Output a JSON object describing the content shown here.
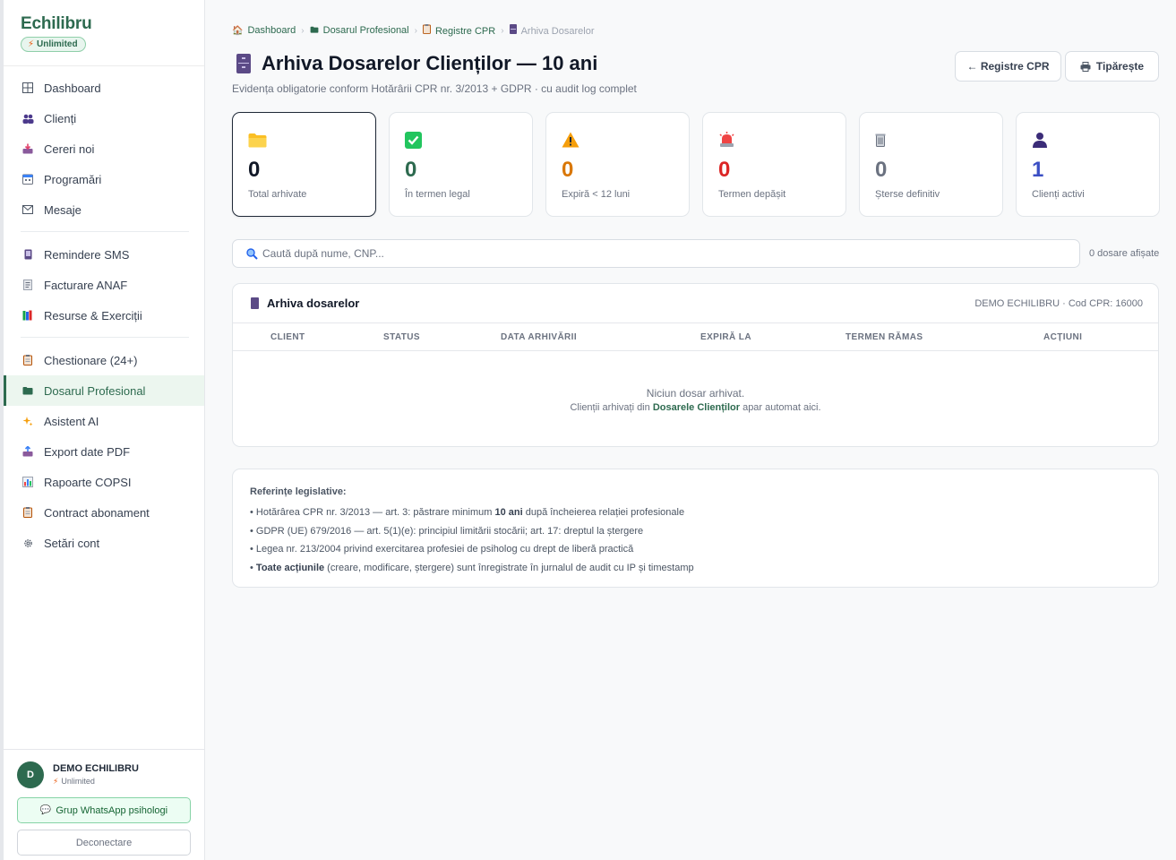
{
  "sidebar": {
    "brand": "Echilibru",
    "plan": "Unlimited",
    "groups": [
      [
        {
          "label": "Dashboard",
          "icon": "grid-icon"
        },
        {
          "label": "Clienți",
          "icon": "people-icon"
        },
        {
          "label": "Cereri noi",
          "icon": "inbox-tray-icon"
        },
        {
          "label": "Programări",
          "icon": "calendar-icon"
        },
        {
          "label": "Mesaje",
          "icon": "envelope-icon"
        }
      ],
      [
        {
          "label": "Remindere SMS",
          "icon": "mobile-phone-icon"
        },
        {
          "label": "Facturare ANAF",
          "icon": "receipt-icon"
        },
        {
          "label": "Resurse & Exerciții",
          "icon": "books-icon"
        }
      ],
      [
        {
          "label": "Chestionare (24+)",
          "icon": "clipboard-icon"
        },
        {
          "label": "Dosarul Profesional",
          "icon": "folder-icon",
          "active": true
        },
        {
          "label": "Asistent AI",
          "icon": "sparkles-icon"
        },
        {
          "label": "Export date PDF",
          "icon": "outbox-tray-icon"
        },
        {
          "label": "Rapoarte COPSI",
          "icon": "bar-chart-icon"
        },
        {
          "label": "Contract abonament",
          "icon": "document-icon"
        },
        {
          "label": "Setări cont",
          "icon": "gear-icon"
        }
      ]
    ],
    "user": {
      "initial": "D",
      "name": "DEMO ECHILIBRU",
      "plan": "Unlimited"
    },
    "whatsapp_label": "Grup WhatsApp psihologi",
    "logout_label": "Deconectare"
  },
  "breadcrumb": [
    {
      "label": "Dashboard",
      "icon": "house-icon"
    },
    {
      "label": "Dosarul Profesional",
      "icon": "folder-icon"
    },
    {
      "label": "Registre CPR",
      "icon": "clipboard-icon"
    },
    {
      "label": "Arhiva Dosarelor",
      "icon": "file-cabinet-icon",
      "current": true
    }
  ],
  "page": {
    "title": "Arhiva Dosarelor Clienților — 10 ani",
    "subtitle": "Evidența obligatorie conform Hotărârii CPR nr. 3/2013 + GDPR · cu audit log complet",
    "back_button": "← Registre CPR",
    "print_button": "Tipărește"
  },
  "stats": [
    {
      "value": "0",
      "label": "Total arhivate",
      "icon": "folder-icon",
      "color": "#111827",
      "selected": true
    },
    {
      "value": "0",
      "label": "În termen legal",
      "icon": "check-box-icon",
      "color": "#2d6a4f"
    },
    {
      "value": "0",
      "label": "Expiră < 12 luni",
      "icon": "warning-icon",
      "color": "#d97706"
    },
    {
      "value": "0",
      "label": "Termen depășit",
      "icon": "siren-icon",
      "color": "#dc2626"
    },
    {
      "value": "0",
      "label": "Șterse definitiv",
      "icon": "trash-icon",
      "color": "#6b7280"
    },
    {
      "value": "1",
      "label": "Clienți activi",
      "icon": "user-icon",
      "color": "#3b4fc4"
    }
  ],
  "search": {
    "placeholder": "Caută după nume, CNP...",
    "count_text": "0 dosare afișate"
  },
  "archive": {
    "title": "Arhiva dosarelor",
    "meta": "DEMO ECHILIBRU · Cod CPR: 16000",
    "columns": [
      "CLIENT",
      "STATUS",
      "DATA ARHIVĂRII",
      "EXPIRĂ LA",
      "TERMEN RĂMAS",
      "ACȚIUNI"
    ],
    "empty_title": "Niciun dosar arhivat.",
    "empty_prefix": "Clienții arhivați din ",
    "empty_link": "Dosarele Clienților",
    "empty_suffix": " apar automat aici."
  },
  "legal": {
    "title": "Referințe legislative:",
    "l1_a": "• Hotărârea CPR nr. 3/2013 — art. 3: păstrare minimum ",
    "l1_b": "10 ani",
    "l1_c": " după încheierea relației profesionale",
    "l2": "• GDPR (UE) 679/2016 — art. 5(1)(e): principiul limitării stocării; art. 17: dreptul la ștergere",
    "l3": "• Legea nr. 213/2004 privind exercitarea profesiei de psiholog cu drept de liberă practică",
    "l4_a": "• ",
    "l4_b": "Toate acțiunile",
    "l4_c": " (creare, modificare, ștergere) sunt înregistrate în jurnalul de audit cu IP și timestamp"
  }
}
